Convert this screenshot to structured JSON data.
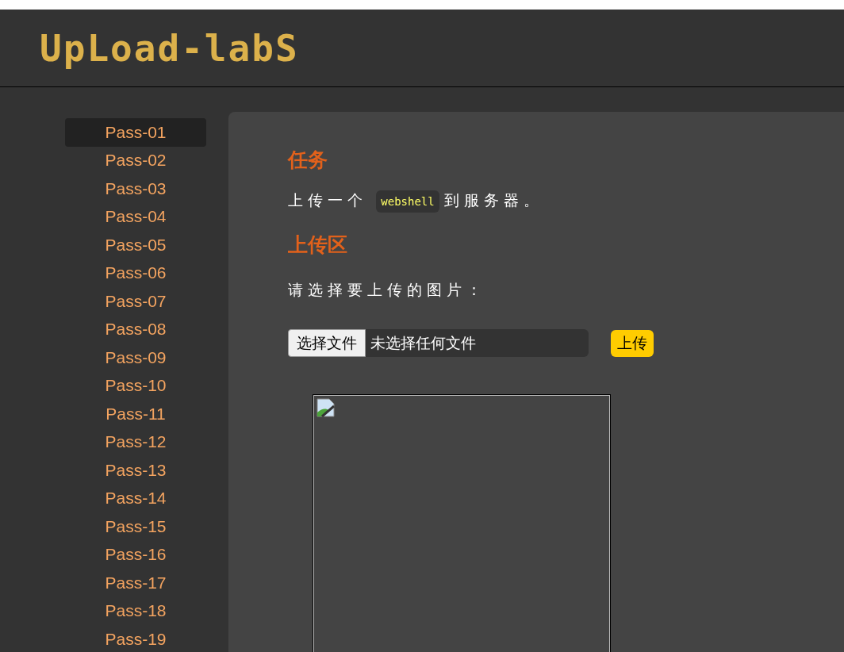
{
  "header": {
    "logo": "UpLoad-labS"
  },
  "sidebar": {
    "items": [
      {
        "label": "Pass-01",
        "selected": true
      },
      {
        "label": "Pass-02",
        "selected": false
      },
      {
        "label": "Pass-03",
        "selected": false
      },
      {
        "label": "Pass-04",
        "selected": false
      },
      {
        "label": "Pass-05",
        "selected": false
      },
      {
        "label": "Pass-06",
        "selected": false
      },
      {
        "label": "Pass-07",
        "selected": false
      },
      {
        "label": "Pass-08",
        "selected": false
      },
      {
        "label": "Pass-09",
        "selected": false
      },
      {
        "label": "Pass-10",
        "selected": false
      },
      {
        "label": "Pass-11",
        "selected": false
      },
      {
        "label": "Pass-12",
        "selected": false
      },
      {
        "label": "Pass-13",
        "selected": false
      },
      {
        "label": "Pass-14",
        "selected": false
      },
      {
        "label": "Pass-15",
        "selected": false
      },
      {
        "label": "Pass-16",
        "selected": false
      },
      {
        "label": "Pass-17",
        "selected": false
      },
      {
        "label": "Pass-18",
        "selected": false
      },
      {
        "label": "Pass-19",
        "selected": false
      }
    ]
  },
  "content": {
    "task_heading": "任务",
    "task_text_before": "上传一个",
    "task_code": "webshell",
    "task_text_after": "到服务器。",
    "upload_heading": "上传区",
    "upload_prompt": "请选择要上传的图片：",
    "file_button": "选择文件",
    "file_status": "未选择任何文件",
    "upload_button": "上传",
    "preview": {
      "broken": true
    }
  }
}
